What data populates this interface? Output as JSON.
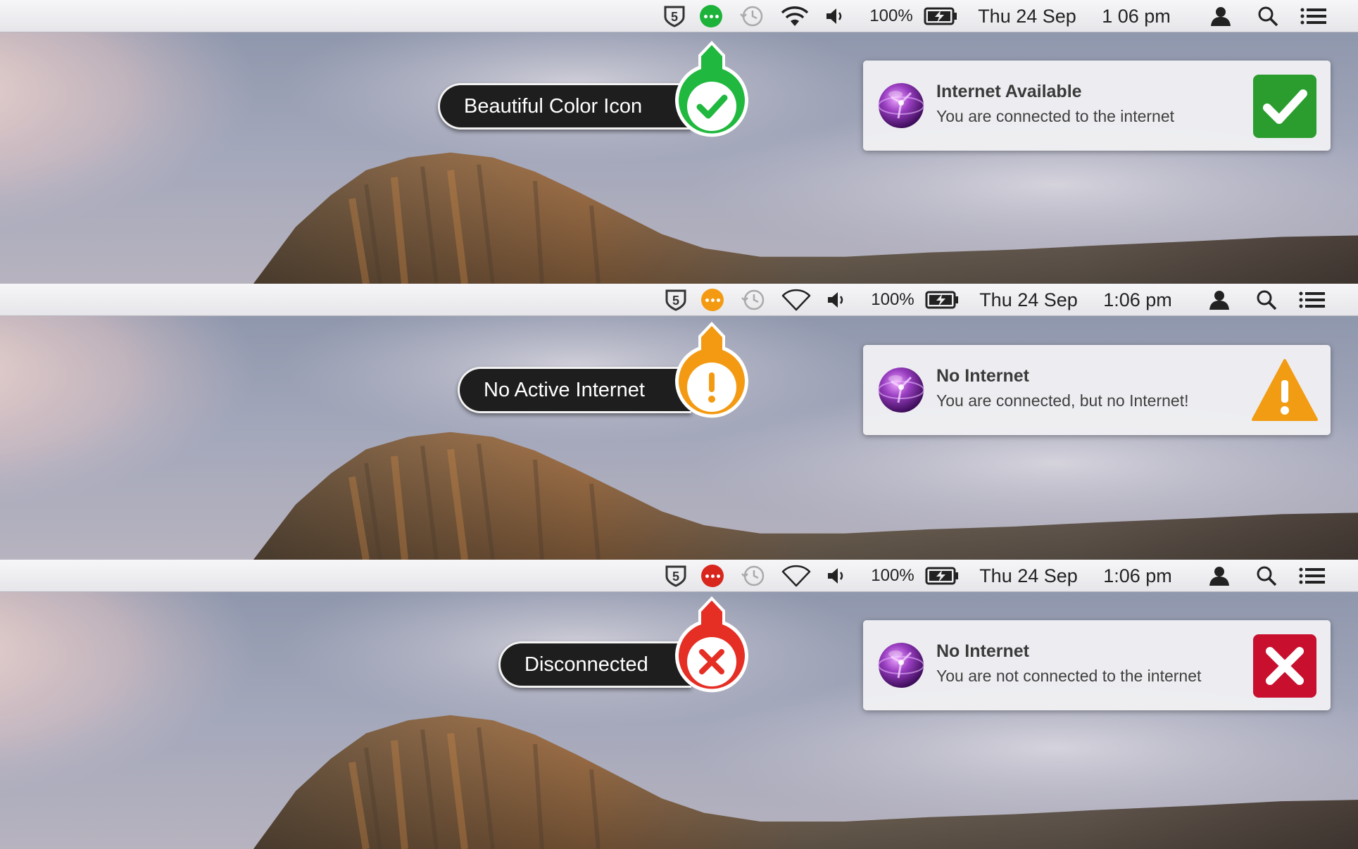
{
  "menubar": {
    "battery_percent": "100%",
    "date": "Thu 24 Sep",
    "time_first": "1 06 pm",
    "time": "1:06 pm"
  },
  "colors": {
    "connected": "#1db33b",
    "no_internet": "#f39a12",
    "disconnected": "#d8261c",
    "connected_dark": "#2a9d2e",
    "warning": "#f19c13",
    "error": "#c8102e"
  },
  "panels": [
    {
      "status": "connected",
      "status_icon": "ellipsis-green-icon",
      "callout_label": "Beautiful Color Icon",
      "callout_icon": "checkmark-icon",
      "notification": {
        "title": "Internet Available",
        "message": "You are connected to the internet",
        "state_icon": "checkmark-icon"
      }
    },
    {
      "status": "no-internet",
      "status_icon": "ellipsis-orange-icon",
      "callout_label": "No Active Internet",
      "callout_icon": "exclamation-icon",
      "notification": {
        "title": "No Internet",
        "message": "You are connected, but no Internet!",
        "state_icon": "warning-triangle-icon"
      }
    },
    {
      "status": "disconnected",
      "status_icon": "ellipsis-red-icon",
      "callout_label": "Disconnected",
      "callout_icon": "cross-icon",
      "notification": {
        "title": "No Internet",
        "message": "You are not connected to the internet",
        "state_icon": "cross-icon"
      }
    }
  ]
}
